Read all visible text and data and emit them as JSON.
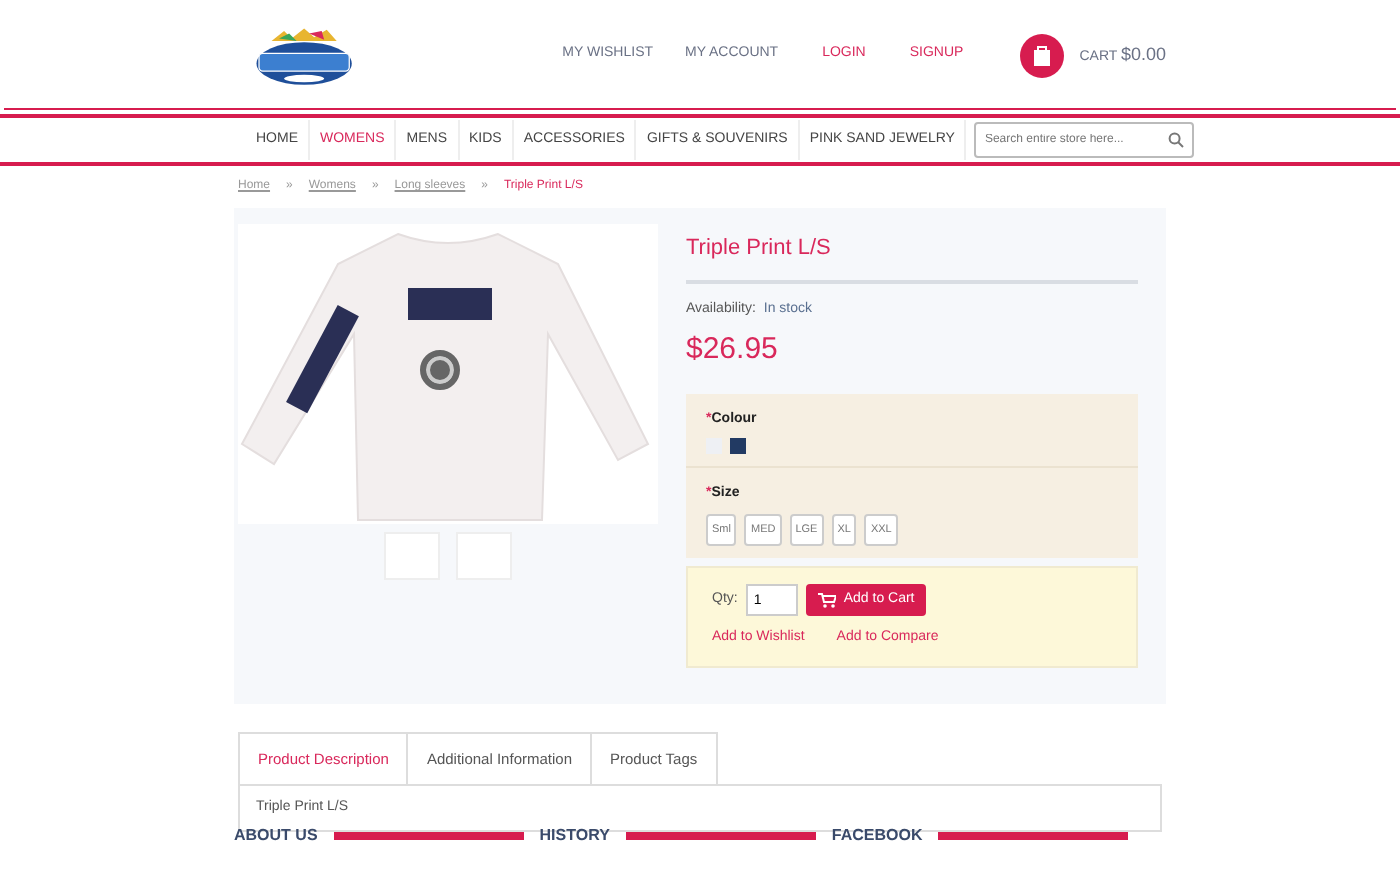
{
  "header": {
    "links": [
      {
        "label": "MY WISHLIST",
        "kind": "plain"
      },
      {
        "label": "MY ACCOUNT",
        "kind": "plain"
      },
      {
        "label": "LOGIN",
        "kind": "accent"
      },
      {
        "label": "SIGNUP",
        "kind": "accent"
      }
    ],
    "cart": {
      "label": "CART",
      "amount": "$0.00"
    }
  },
  "nav": {
    "items": [
      {
        "label": "HOME",
        "selected": false
      },
      {
        "label": "WOMENS",
        "selected": true
      },
      {
        "label": "MENS",
        "selected": false
      },
      {
        "label": "KIDS",
        "selected": false
      },
      {
        "label": "ACCESSORIES",
        "selected": false
      },
      {
        "label": "GIFTS & SOUVENIRS",
        "selected": false
      },
      {
        "label": "PINK SAND JEWELRY",
        "selected": false
      }
    ],
    "search": {
      "placeholder": "Search entire store here..."
    }
  },
  "breadcrumb_separator": "»",
  "required_mark": "*",
  "breadcrumb": [
    {
      "label": "Home",
      "current": false
    },
    {
      "label": "Womens",
      "current": false
    },
    {
      "label": "Long sleeves",
      "current": false
    },
    {
      "label": "Triple Print L/S",
      "current": true
    }
  ],
  "product": {
    "title": "Triple Print L/S",
    "availability_label": "Availability:",
    "availability": "In stock",
    "price": "$26.95",
    "colour": {
      "label": "Colour",
      "swatches": [
        {
          "color": "#eef0f4"
        },
        {
          "color": "#223a63"
        }
      ]
    },
    "size": {
      "label": "Size",
      "options": [
        "Sml",
        "MED",
        "LGE",
        "XL",
        "XXL"
      ]
    },
    "qty_label": "Qty:",
    "qty": "1",
    "add_to_cart": "Add to Cart",
    "links": [
      "Add to Wishlist",
      "Add to Compare"
    ]
  },
  "tabs": [
    {
      "label": "Product Description",
      "selected": true
    },
    {
      "label": "Additional Information",
      "selected": false
    },
    {
      "label": "Product Tags",
      "selected": false
    }
  ],
  "tab_content": "Triple Print L/S",
  "footer": [
    "ABOUT US",
    "HISTORY",
    "FACEBOOK"
  ]
}
